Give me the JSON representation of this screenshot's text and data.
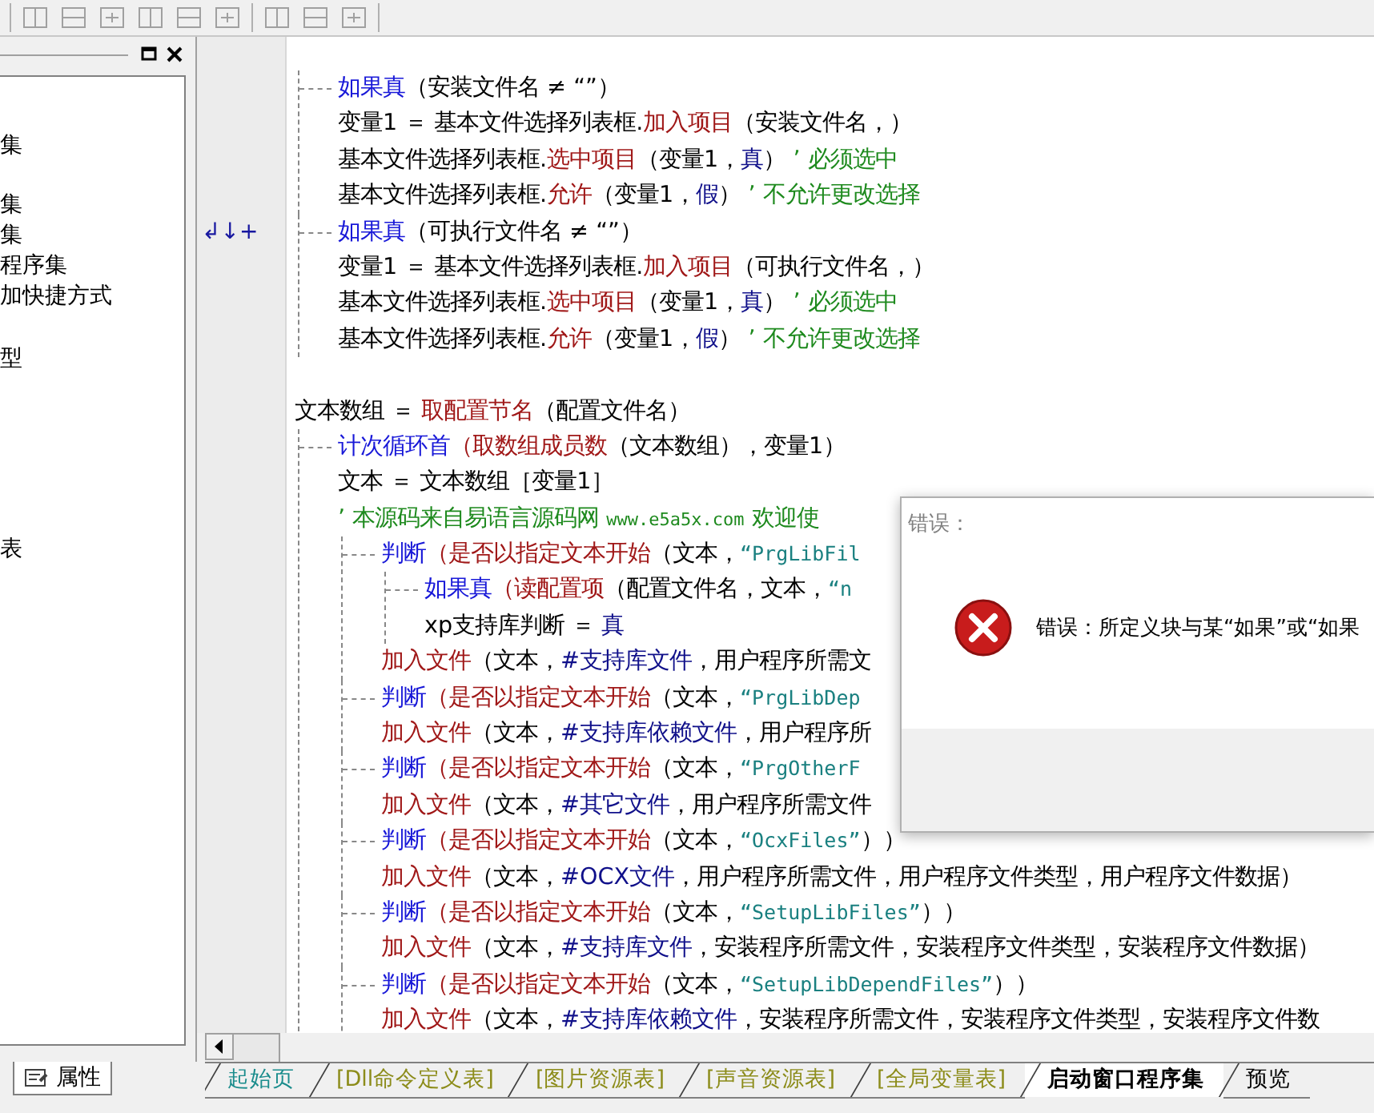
{
  "left_panel": {
    "tree_items": [
      {
        "label": "集"
      },
      {
        "label": "集"
      },
      {
        "label": "集"
      },
      {
        "label": "程序集"
      },
      {
        "label": "加快捷方式"
      },
      {
        "label": "型"
      },
      {
        "label": "表"
      }
    ],
    "bottom_tab": {
      "label": "属性"
    }
  },
  "code": [
    {
      "kind": "block",
      "segments": [
        {
          "kind": "kw",
          "text": "如果真"
        },
        {
          "kind": "p",
          "text": "（安装文件名 ≠ “”）"
        }
      ],
      "children": [
        {
          "kind": "line",
          "segments": [
            {
              "kind": "p",
              "text": "变量1 ＝ 基本文件选择列表框."
            },
            {
              "kind": "fn",
              "text": "加入项目"
            },
            {
              "kind": "p",
              "text": "（安装文件名，）"
            }
          ]
        },
        {
          "kind": "line",
          "segments": [
            {
              "kind": "p",
              "text": "基本文件选择列表框."
            },
            {
              "kind": "fn",
              "text": "选中项目"
            },
            {
              "kind": "p",
              "text": "（变量1，"
            },
            {
              "kind": "c",
              "text": "真"
            },
            {
              "kind": "p",
              "text": "）"
            },
            {
              "kind": "cm",
              "text": " ’ 必须选中"
            }
          ]
        },
        {
          "kind": "line",
          "segments": [
            {
              "kind": "p",
              "text": "基本文件选择列表框."
            },
            {
              "kind": "fn",
              "text": "允许"
            },
            {
              "kind": "p",
              "text": "（变量1，"
            },
            {
              "kind": "c",
              "text": "假"
            },
            {
              "kind": "p",
              "text": "）"
            },
            {
              "kind": "cm",
              "text": " ’ 不允许更改选择"
            }
          ]
        }
      ]
    },
    {
      "kind": "block",
      "marker": "↲↓+",
      "segments": [
        {
          "kind": "kw",
          "text": "如果真"
        },
        {
          "kind": "p",
          "text": "（可执行文件名 ≠ “”）"
        }
      ],
      "children": [
        {
          "kind": "line",
          "segments": [
            {
              "kind": "p",
              "text": "变量1 ＝ 基本文件选择列表框."
            },
            {
              "kind": "fn",
              "text": "加入项目"
            },
            {
              "kind": "p",
              "text": "（可执行文件名，）"
            }
          ]
        },
        {
          "kind": "line",
          "segments": [
            {
              "kind": "p",
              "text": "基本文件选择列表框."
            },
            {
              "kind": "fn",
              "text": "选中项目"
            },
            {
              "kind": "p",
              "text": "（变量1，"
            },
            {
              "kind": "c",
              "text": "真"
            },
            {
              "kind": "p",
              "text": "）"
            },
            {
              "kind": "cm",
              "text": " ’ 必须选中"
            }
          ]
        },
        {
          "kind": "line",
          "segments": [
            {
              "kind": "p",
              "text": "基本文件选择列表框."
            },
            {
              "kind": "fn",
              "text": "允许"
            },
            {
              "kind": "p",
              "text": "（变量1，"
            },
            {
              "kind": "c",
              "text": "假"
            },
            {
              "kind": "p",
              "text": "）"
            },
            {
              "kind": "cm",
              "text": " ’ 不允许更改选择"
            }
          ]
        }
      ]
    },
    {
      "kind": "blank"
    },
    {
      "kind": "line",
      "segments": [
        {
          "kind": "p",
          "text": "文本数组 ＝ "
        },
        {
          "kind": "fn",
          "text": "取配置节名"
        },
        {
          "kind": "p",
          "text": "（配置文件名）"
        }
      ]
    },
    {
      "kind": "block",
      "segments": [
        {
          "kind": "kw",
          "text": "计次循环首"
        },
        {
          "kind": "fn",
          "text": "（取数组成员数"
        },
        {
          "kind": "p",
          "text": "（文本数组），变量1）"
        }
      ],
      "children": [
        {
          "kind": "line",
          "segments": [
            {
              "kind": "p",
              "text": "文本 ＝ 文本数组［变量1］"
            }
          ]
        },
        {
          "kind": "line",
          "segments": [
            {
              "kind": "cm",
              "text": "’ 本源码来自易语言源码网 "
            },
            {
              "kind": "url",
              "text": "www.e5a5x.com"
            },
            {
              "kind": "cm",
              "text": "  欢迎使"
            }
          ]
        },
        {
          "kind": "block",
          "segments": [
            {
              "kind": "kw",
              "text": "判断"
            },
            {
              "kind": "fn",
              "text": "（是否以指定文本开始"
            },
            {
              "kind": "p",
              "text": "（文本，"
            },
            {
              "kind": "s",
              "text": "“PrgLibFil"
            }
          ],
          "children": [
            {
              "kind": "block",
              "segments": [
                {
                  "kind": "kw",
                  "text": "如果真"
                },
                {
                  "kind": "fn",
                  "text": "（读配置项"
                },
                {
                  "kind": "p",
                  "text": "（配置文件名，文本，"
                },
                {
                  "kind": "s",
                  "text": "“n"
                }
              ],
              "children": [
                {
                  "kind": "line",
                  "segments": [
                    {
                      "kind": "p",
                      "text": "xp支持库判断 ＝ "
                    },
                    {
                      "kind": "c",
                      "text": "真"
                    }
                  ]
                }
              ]
            },
            {
              "kind": "line",
              "segments": [
                {
                  "kind": "fn",
                  "text": "加入文件"
                },
                {
                  "kind": "p",
                  "text": "（文本，"
                },
                {
                  "kind": "c",
                  "text": "#支持库文件"
                },
                {
                  "kind": "p",
                  "text": "，用户程序所需文"
                }
              ]
            }
          ]
        },
        {
          "kind": "block",
          "segments": [
            {
              "kind": "kw",
              "text": "判断"
            },
            {
              "kind": "fn",
              "text": "（是否以指定文本开始"
            },
            {
              "kind": "p",
              "text": "（文本，"
            },
            {
              "kind": "s",
              "text": "“PrgLibDep"
            }
          ],
          "children": [
            {
              "kind": "line",
              "segments": [
                {
                  "kind": "fn",
                  "text": "加入文件"
                },
                {
                  "kind": "p",
                  "text": "（文本，"
                },
                {
                  "kind": "c",
                  "text": "#支持库依赖文件"
                },
                {
                  "kind": "p",
                  "text": "，用户程序所"
                }
              ]
            }
          ]
        },
        {
          "kind": "block",
          "segments": [
            {
              "kind": "kw",
              "text": "判断"
            },
            {
              "kind": "fn",
              "text": "（是否以指定文本开始"
            },
            {
              "kind": "p",
              "text": "（文本，"
            },
            {
              "kind": "s",
              "text": "“PrgOtherF"
            }
          ],
          "children": [
            {
              "kind": "line",
              "segments": [
                {
                  "kind": "fn",
                  "text": "加入文件"
                },
                {
                  "kind": "p",
                  "text": "（文本，"
                },
                {
                  "kind": "c",
                  "text": "#其它文件"
                },
                {
                  "kind": "p",
                  "text": "，用户程序所需文件"
                }
              ]
            }
          ]
        },
        {
          "kind": "block",
          "segments": [
            {
              "kind": "kw",
              "text": "判断"
            },
            {
              "kind": "fn",
              "text": "（是否以指定文本开始"
            },
            {
              "kind": "p",
              "text": "（文本，"
            },
            {
              "kind": "s",
              "text": "“OcxFiles”"
            },
            {
              "kind": "p",
              "text": "））"
            }
          ],
          "children": [
            {
              "kind": "line",
              "segments": [
                {
                  "kind": "fn",
                  "text": "加入文件"
                },
                {
                  "kind": "p",
                  "text": "（文本，"
                },
                {
                  "kind": "c",
                  "text": "#OCX文件"
                },
                {
                  "kind": "p",
                  "text": "，用户程序所需文件，用户程序文件类型，用户程序文件数据）"
                }
              ]
            }
          ]
        },
        {
          "kind": "block",
          "segments": [
            {
              "kind": "kw",
              "text": "判断"
            },
            {
              "kind": "fn",
              "text": "（是否以指定文本开始"
            },
            {
              "kind": "p",
              "text": "（文本，"
            },
            {
              "kind": "s",
              "text": "“SetupLibFiles”"
            },
            {
              "kind": "p",
              "text": "））"
            }
          ],
          "children": [
            {
              "kind": "line",
              "segments": [
                {
                  "kind": "fn",
                  "text": "加入文件"
                },
                {
                  "kind": "p",
                  "text": "（文本，"
                },
                {
                  "kind": "c",
                  "text": "#支持库文件"
                },
                {
                  "kind": "p",
                  "text": "，安装程序所需文件，安装程序文件类型，安装程序文件数据）"
                }
              ]
            }
          ]
        },
        {
          "kind": "block",
          "segments": [
            {
              "kind": "kw",
              "text": "判断"
            },
            {
              "kind": "fn",
              "text": "（是否以指定文本开始"
            },
            {
              "kind": "p",
              "text": "（文本，"
            },
            {
              "kind": "s",
              "text": "“SetupLibDependFiles”"
            },
            {
              "kind": "p",
              "text": "））"
            }
          ],
          "children": [
            {
              "kind": "line",
              "segments": [
                {
                  "kind": "fn",
                  "text": "加入文件"
                },
                {
                  "kind": "p",
                  "text": "（文本，"
                },
                {
                  "kind": "c",
                  "text": "#支持库依赖文件"
                },
                {
                  "kind": "p",
                  "text": "，安装程序所需文件，安装程序文件类型，安装程序文件数"
                }
              ]
            }
          ]
        }
      ]
    }
  ],
  "dialog": {
    "title": "错误：",
    "message": "错误：所定义块与某“如果”或“如果"
  },
  "tabs": [
    {
      "label": "起始页",
      "color": "#1a8c8c",
      "selected": false
    },
    {
      "label": "[Dll命令定义表]",
      "color": "#8c8c1a",
      "selected": false
    },
    {
      "label": "[图片资源表]",
      "color": "#8c8c1a",
      "selected": false
    },
    {
      "label": "[声音资源表]",
      "color": "#8c8c1a",
      "selected": false
    },
    {
      "label": "[全局变量表]",
      "color": "#8c8c1a",
      "selected": false
    },
    {
      "label": "启动窗口程序集",
      "color": "#000000",
      "selected": true
    },
    {
      "label": "预览",
      "color": "#000000",
      "selected": false
    }
  ]
}
